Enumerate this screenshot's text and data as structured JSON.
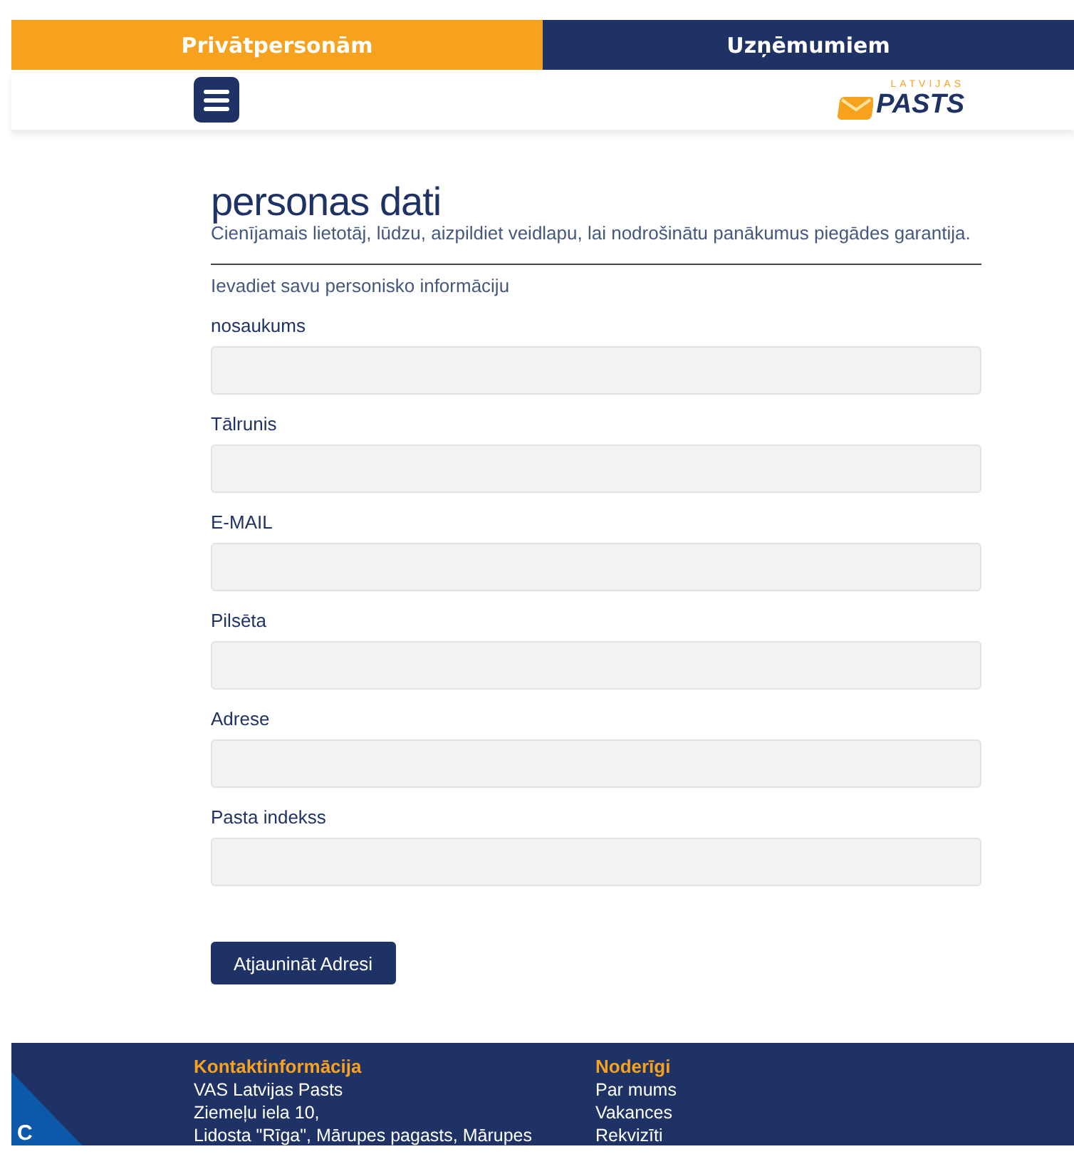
{
  "tabs": [
    {
      "label": "Privātpersonām",
      "selected": true
    },
    {
      "label": "Uzņēmumiem",
      "selected": false
    }
  ],
  "header": {
    "logo": {
      "small": "LATVIJAS",
      "main": "PASTS"
    }
  },
  "form": {
    "title": "personas dati",
    "subtitle": "Cienījamais lietotāj, lūdzu, aizpildiet veidlapu, lai nodrošinātu panākumus piegādes garantija.",
    "intro": "Ievadiet savu personisko informāciju",
    "fields": [
      {
        "label": "nosaukums"
      },
      {
        "label": "Tālrunis"
      },
      {
        "label": "E-MAIL"
      },
      {
        "label": "Pilsēta"
      },
      {
        "label": "Adrese"
      },
      {
        "label": "Pasta indekss"
      }
    ],
    "button": "Atjaunināt Adresi"
  },
  "footer": {
    "corner_badge": "C",
    "columns": [
      {
        "heading": "Kontaktinformācija",
        "lines": [
          "VAS Latvijas Pasts",
          "Ziemeļu iela 10,",
          "Lidosta \"Rīga\", Mārupes pagasts, Mārupes"
        ]
      },
      {
        "heading": "Noderīgi",
        "lines": [
          "Par mums",
          "Vakances",
          "Rekvizīti"
        ]
      }
    ]
  }
}
